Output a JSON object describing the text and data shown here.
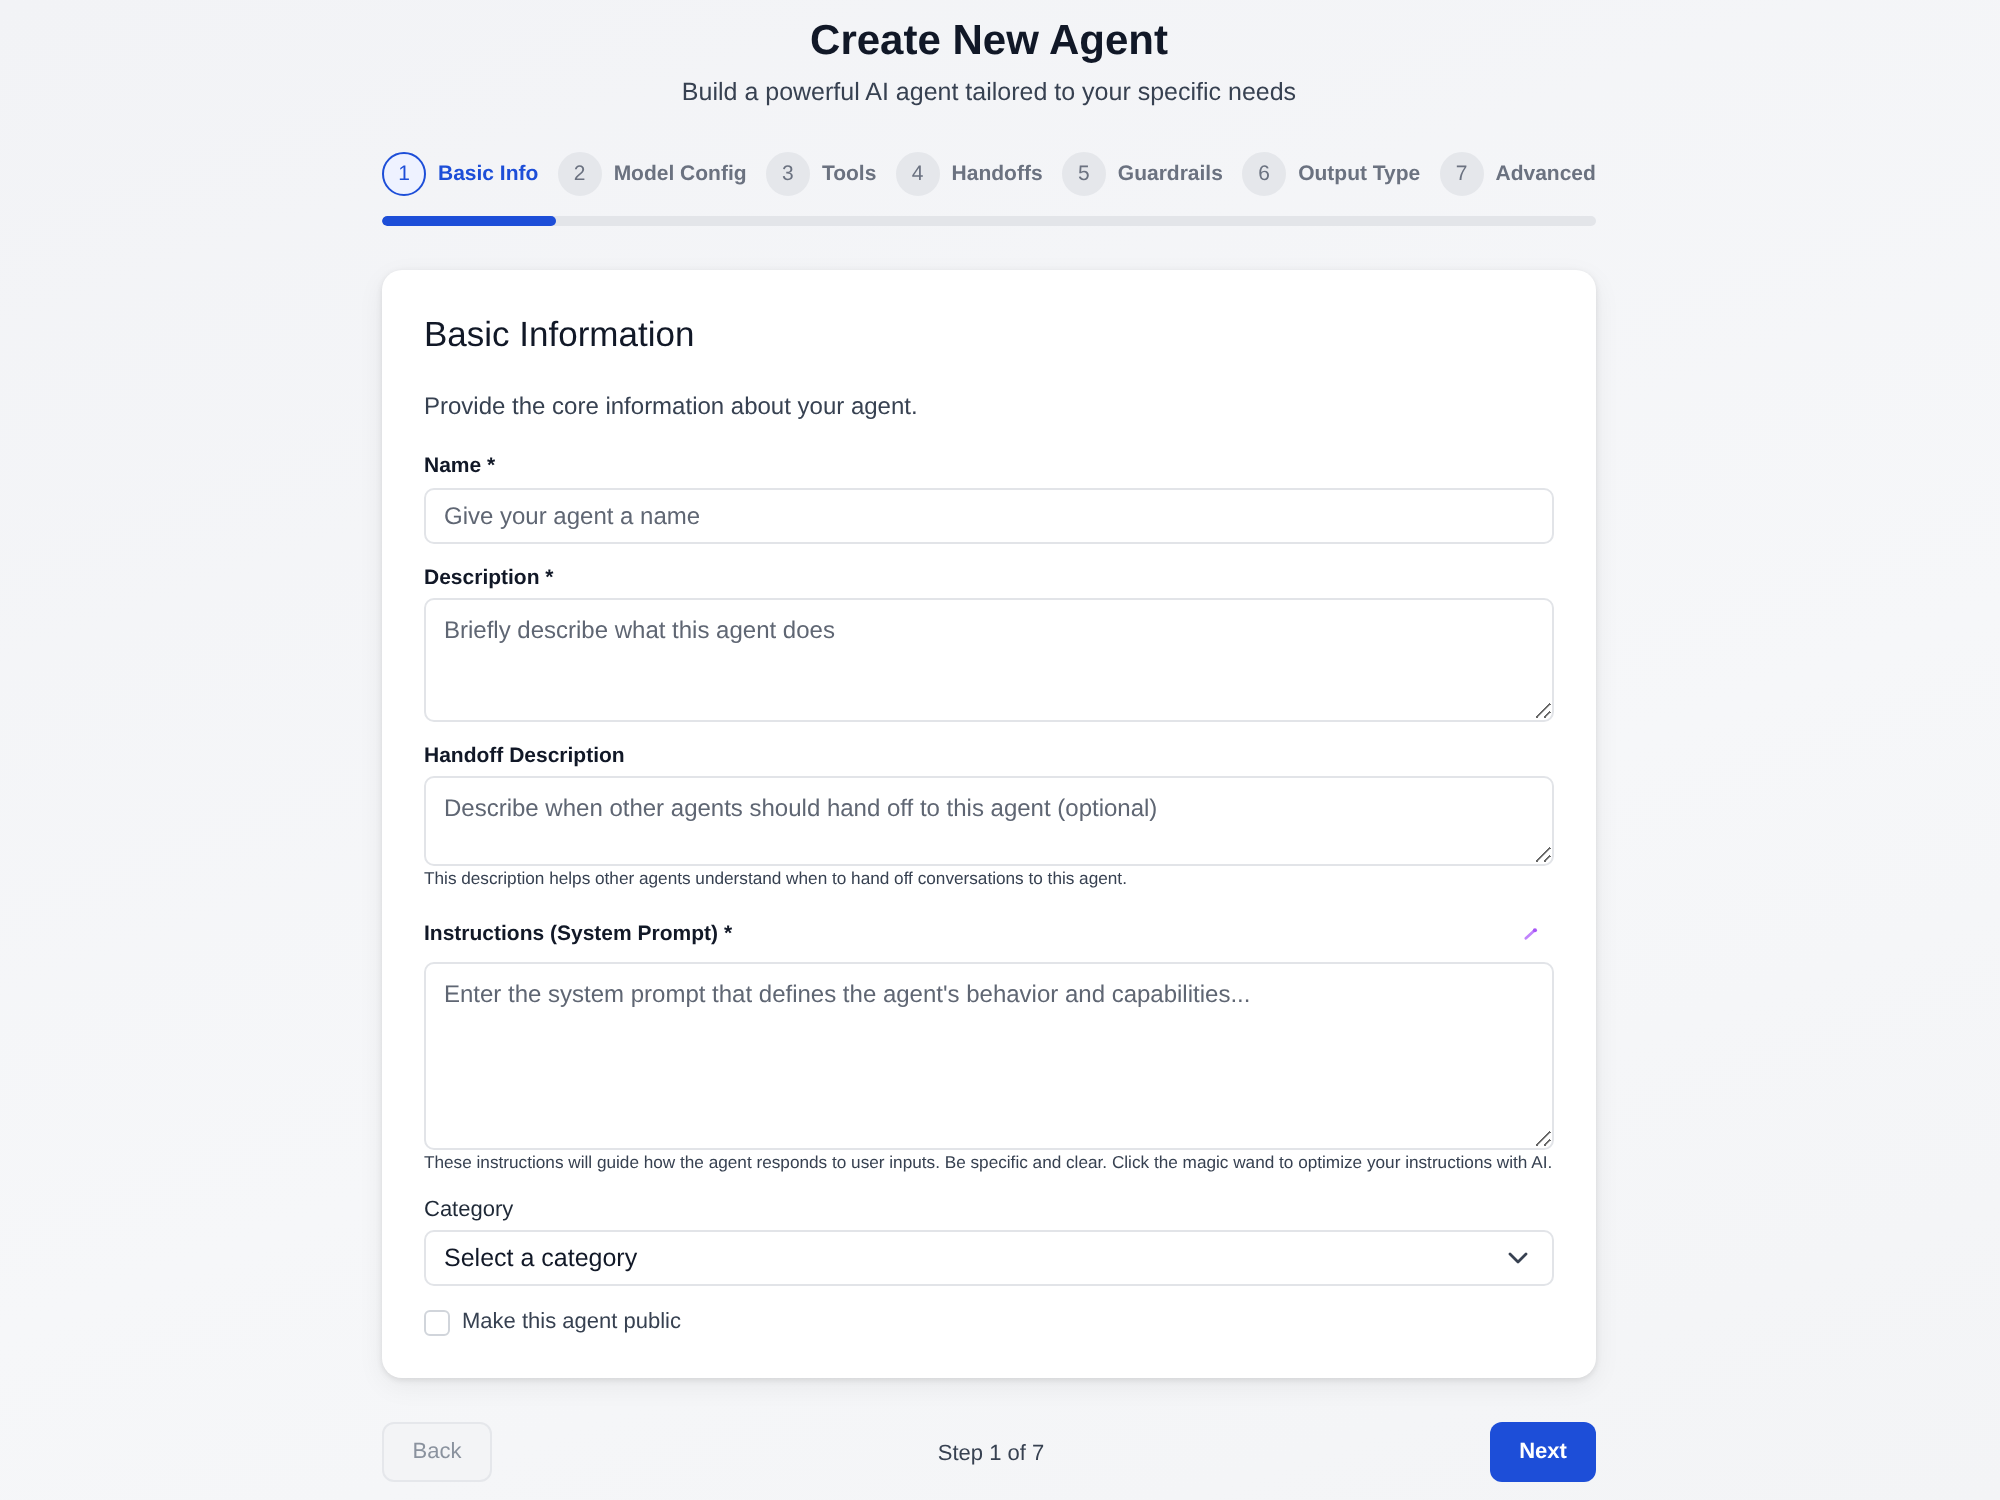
{
  "header": {
    "title": "Create New Agent",
    "subtitle": "Build a powerful AI agent tailored to your specific needs"
  },
  "steps": [
    {
      "number": "1",
      "label": "Basic Info",
      "selected": true
    },
    {
      "number": "2",
      "label": "Model Config",
      "selected": false
    },
    {
      "number": "3",
      "label": "Tools",
      "selected": false
    },
    {
      "number": "4",
      "label": "Handoffs",
      "selected": false
    },
    {
      "number": "5",
      "label": "Guardrails",
      "selected": false
    },
    {
      "number": "6",
      "label": "Output Type",
      "selected": false
    },
    {
      "number": "7",
      "label": "Advanced",
      "selected": false
    }
  ],
  "progress": {
    "level": 0.143
  },
  "form": {
    "heading": "Basic Information",
    "description": "Provide the core information about your agent.",
    "name": {
      "label": "Name *",
      "placeholder": "Give your agent a name"
    },
    "description_field": {
      "label": "Description *",
      "placeholder": "Briefly describe what this agent does"
    },
    "handoff_description": {
      "label": "Handoff Description",
      "placeholder": "Describe when other agents should hand off to this agent (optional)",
      "help": "This description helps other agents understand when to hand off conversations to this agent."
    },
    "instructions": {
      "label": "Instructions (System Prompt) *",
      "placeholder": "Enter the system prompt that defines the agent's behavior and capabilities...",
      "help": "These instructions will guide how the agent responds to user inputs. Be specific and clear. Click the magic wand to optimize your instructions with AI."
    },
    "category": {
      "label": "Category",
      "value": "Select a category"
    },
    "public": {
      "label": "Make this agent public",
      "checked": false
    }
  },
  "footer": {
    "back": {
      "label": "Back",
      "disabled": true
    },
    "step_text": "Step 1 of 7",
    "next": {
      "label": "Next",
      "disabled": false
    }
  }
}
